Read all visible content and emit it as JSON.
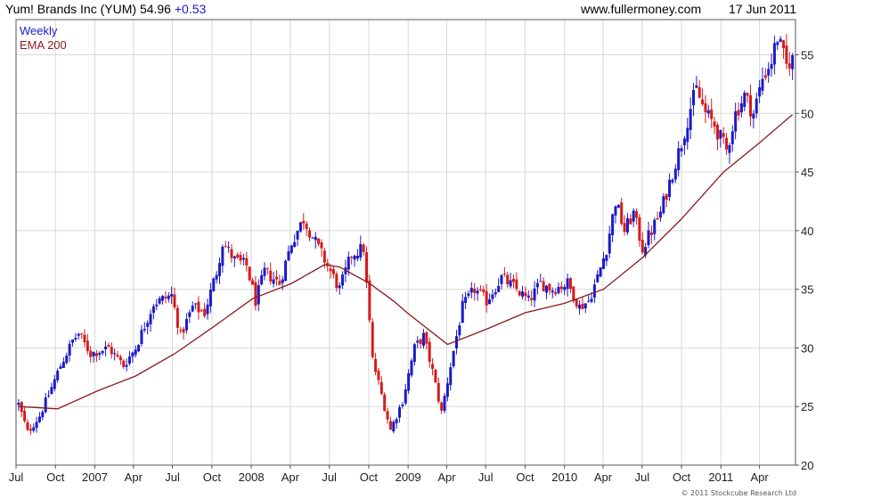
{
  "header": {
    "title": "Yum! Brands Inc (YUM)",
    "price": "54.96",
    "change": "+0.53",
    "site": "www.fullermoney.com",
    "date": "17 Jun 2011"
  },
  "footer": {
    "copyright": "© 2011 Stockcube Research Ltd"
  },
  "colors": {
    "up": "#1a1acc",
    "down": "#d81a1a",
    "ema": "#8b1a1a",
    "grid": "#d8d8d8",
    "frame": "#555555"
  },
  "chart_data": {
    "type": "candlestick",
    "grid": true,
    "legend_position": "top-left",
    "legend": [
      {
        "label": "Weekly",
        "color": "#1a1acc"
      },
      {
        "label": "EMA 200",
        "color": "#8b1a1a"
      }
    ],
    "ylim": [
      20,
      58
    ],
    "yticks": [
      20,
      25,
      30,
      35,
      40,
      45,
      50,
      55
    ],
    "xlim": [
      "2006-07-01",
      "2011-06-24"
    ],
    "xticks": [
      {
        "label": "Jul",
        "date": "2006-07-01"
      },
      {
        "label": "Oct",
        "date": "2006-10-01"
      },
      {
        "label": "2007",
        "date": "2007-01-01"
      },
      {
        "label": "Apr",
        "date": "2007-04-01"
      },
      {
        "label": "Jul",
        "date": "2007-07-01"
      },
      {
        "label": "Oct",
        "date": "2007-10-01"
      },
      {
        "label": "2008",
        "date": "2008-01-01"
      },
      {
        "label": "Apr",
        "date": "2008-04-01"
      },
      {
        "label": "Jul",
        "date": "2008-07-01"
      },
      {
        "label": "Oct",
        "date": "2008-10-01"
      },
      {
        "label": "2009",
        "date": "2009-01-01"
      },
      {
        "label": "Apr",
        "date": "2009-04-01"
      },
      {
        "label": "Jul",
        "date": "2009-07-01"
      },
      {
        "label": "Oct",
        "date": "2009-10-01"
      },
      {
        "label": "2010",
        "date": "2010-01-01"
      },
      {
        "label": "Apr",
        "date": "2010-04-01"
      },
      {
        "label": "Jul",
        "date": "2010-07-01"
      },
      {
        "label": "Oct",
        "date": "2010-10-01"
      },
      {
        "label": "2011",
        "date": "2011-01-01"
      },
      {
        "label": "Apr",
        "date": "2011-04-01"
      }
    ],
    "close_keypoints": [
      [
        "2006-07-07",
        25.2
      ],
      [
        "2006-07-28",
        22.8
      ],
      [
        "2006-08-25",
        24.2
      ],
      [
        "2006-09-15",
        26.0
      ],
      [
        "2006-10-13",
        28.5
      ],
      [
        "2006-11-10",
        30.6
      ],
      [
        "2006-11-24",
        31.2
      ],
      [
        "2006-12-22",
        29.5
      ],
      [
        "2007-02-02",
        30.0
      ],
      [
        "2007-03-09",
        28.5
      ],
      [
        "2007-04-06",
        30.0
      ],
      [
        "2007-05-18",
        33.8
      ],
      [
        "2007-06-29",
        34.5
      ],
      [
        "2007-07-20",
        31.0
      ],
      [
        "2007-08-17",
        33.5
      ],
      [
        "2007-09-14",
        33.0
      ],
      [
        "2007-10-12",
        36.5
      ],
      [
        "2007-10-26",
        39.0
      ],
      [
        "2007-11-23",
        37.5
      ],
      [
        "2007-12-21",
        37.0
      ],
      [
        "2008-01-11",
        34.0
      ],
      [
        "2008-02-01",
        36.5
      ],
      [
        "2008-03-07",
        35.5
      ],
      [
        "2008-04-04",
        39.0
      ],
      [
        "2008-05-02",
        41.0
      ],
      [
        "2008-05-30",
        39.0
      ],
      [
        "2008-06-27",
        37.0
      ],
      [
        "2008-07-25",
        35.0
      ],
      [
        "2008-08-22",
        38.0
      ],
      [
        "2008-09-19",
        38.5
      ],
      [
        "2008-10-10",
        29.0
      ],
      [
        "2008-10-31",
        26.0
      ],
      [
        "2008-11-21",
        23.0
      ],
      [
        "2008-12-19",
        25.5
      ],
      [
        "2009-01-16",
        30.0
      ],
      [
        "2009-02-06",
        31.0
      ],
      [
        "2009-02-27",
        28.0
      ],
      [
        "2009-03-20",
        24.5
      ],
      [
        "2009-04-10",
        28.5
      ],
      [
        "2009-05-08",
        33.5
      ],
      [
        "2009-06-05",
        35.0
      ],
      [
        "2009-07-03",
        34.0
      ],
      [
        "2009-08-07",
        36.0
      ],
      [
        "2009-09-11",
        35.0
      ],
      [
        "2009-10-09",
        34.0
      ],
      [
        "2009-11-06",
        35.5
      ],
      [
        "2009-12-04",
        35.0
      ],
      [
        "2010-01-08",
        35.5
      ],
      [
        "2010-02-05",
        33.5
      ],
      [
        "2010-02-26",
        34.0
      ],
      [
        "2010-03-19",
        36.0
      ],
      [
        "2010-04-09",
        38.5
      ],
      [
        "2010-04-30",
        42.5
      ],
      [
        "2010-05-21",
        40.0
      ],
      [
        "2010-06-11",
        41.5
      ],
      [
        "2010-07-02",
        38.5
      ],
      [
        "2010-07-23",
        40.0
      ],
      [
        "2010-08-13",
        41.5
      ],
      [
        "2010-09-10",
        45.0
      ],
      [
        "2010-10-01",
        47.5
      ],
      [
        "2010-10-22",
        50.5
      ],
      [
        "2010-11-05",
        52.0
      ],
      [
        "2010-11-26",
        50.0
      ],
      [
        "2010-12-17",
        49.0
      ],
      [
        "2011-01-14",
        46.8
      ],
      [
        "2011-02-04",
        50.0
      ],
      [
        "2011-02-25",
        51.5
      ],
      [
        "2011-03-18",
        50.0
      ],
      [
        "2011-04-08",
        53.0
      ],
      [
        "2011-04-29",
        54.5
      ],
      [
        "2011-05-13",
        56.5
      ],
      [
        "2011-06-03",
        54.0
      ],
      [
        "2011-06-17",
        54.96
      ]
    ],
    "ema200_keypoints": [
      [
        "2006-07-07",
        25.0
      ],
      [
        "2006-10-06",
        24.8
      ],
      [
        "2007-01-05",
        26.3
      ],
      [
        "2007-04-06",
        27.6
      ],
      [
        "2007-07-06",
        29.5
      ],
      [
        "2007-10-05",
        31.8
      ],
      [
        "2008-01-04",
        34.2
      ],
      [
        "2008-04-04",
        35.5
      ],
      [
        "2008-06-20",
        37.1
      ],
      [
        "2008-07-25",
        36.9
      ],
      [
        "2008-10-03",
        35.5
      ],
      [
        "2008-11-28",
        34.0
      ],
      [
        "2009-01-02",
        32.9
      ],
      [
        "2009-04-03",
        30.3
      ],
      [
        "2009-07-03",
        31.6
      ],
      [
        "2009-10-02",
        33.0
      ],
      [
        "2010-01-01",
        33.8
      ],
      [
        "2010-04-02",
        35.0
      ],
      [
        "2010-07-02",
        37.7
      ],
      [
        "2010-10-01",
        41.0
      ],
      [
        "2011-01-07",
        45.0
      ],
      [
        "2011-04-01",
        47.5
      ],
      [
        "2011-06-17",
        49.9
      ]
    ]
  }
}
